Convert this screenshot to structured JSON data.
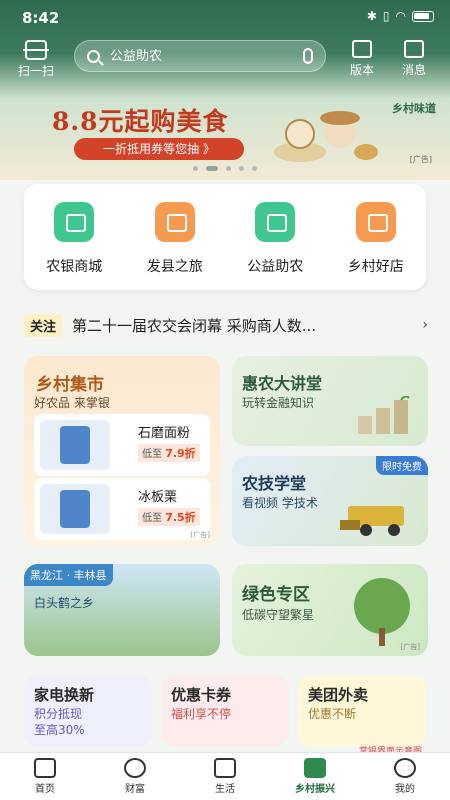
{
  "status": {
    "time": "8:42",
    "battery": "100"
  },
  "topbar": {
    "scan_label": "扫一扫",
    "search_placeholder": "公益助农",
    "version_label": "版本",
    "message_label": "消息"
  },
  "banner": {
    "title": "8.8元起购美食",
    "subtitle": "一折抵用券等您抽 》",
    "brand": "乡村味道",
    "ad": "[广告]",
    "page_count": 5,
    "active_index": 1
  },
  "quick": {
    "items": [
      {
        "label": "农银商城",
        "color": "#3fc78f",
        "icon": "store-icon"
      },
      {
        "label": "发县之旅",
        "color": "#f59a4e",
        "icon": "house-heart-icon"
      },
      {
        "label": "公益助农",
        "color": "#3fc78f",
        "icon": "handshake-heart-icon"
      },
      {
        "label": "乡村好店",
        "color": "#f59a4e",
        "icon": "star-icon"
      }
    ]
  },
  "notice": {
    "tag": "关注",
    "text": "第二十一届农交会闭幕 采购商人数..."
  },
  "market": {
    "title": "乡村集市",
    "subtitle": "好农品 来掌银",
    "products": [
      {
        "name": "石磨面粉",
        "price_prefix": "低至",
        "price": "7.9折"
      },
      {
        "name": "冰板栗",
        "price_prefix": "低至",
        "price": "7.5折"
      }
    ],
    "ad": "[广告]"
  },
  "lecture": {
    "title": "惠农大讲堂",
    "subtitle": "玩转金融知识"
  },
  "tech": {
    "title": "农技学堂",
    "subtitle": "看视频 学技术",
    "badge": "限时免费"
  },
  "county": {
    "tag": "黑龙江 · 丰林县",
    "subtitle": "白头鹤之乡"
  },
  "green": {
    "title": "绿色专区",
    "subtitle": "低碳守望繁星",
    "ad": "[广告]"
  },
  "minis": [
    {
      "title": "家电换新",
      "subtitle": "积分抵现\n至高30%"
    },
    {
      "title": "优惠卡券",
      "subtitle": "福利享不停"
    },
    {
      "title": "美团外卖",
      "subtitle": "优惠不断",
      "note": "掌银界面示意图"
    }
  ],
  "nav": [
    {
      "label": "首页",
      "icon": "home-icon"
    },
    {
      "label": "财富",
      "icon": "yuan-icon"
    },
    {
      "label": "生活",
      "icon": "bag-icon"
    },
    {
      "label": "乡村振兴",
      "icon": "leaf-icon",
      "active": true
    },
    {
      "label": "我的",
      "icon": "person-icon"
    }
  ]
}
